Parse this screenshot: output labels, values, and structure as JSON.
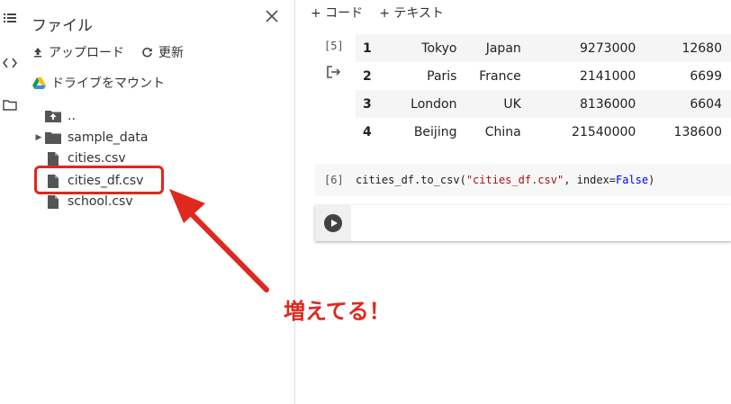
{
  "files_panel": {
    "title": "ファイル",
    "upload_label": "アップロード",
    "refresh_label": "更新",
    "mount_drive_label": "ドライブをマウント",
    "tree": [
      {
        "name": "..",
        "type": "parent-folder"
      },
      {
        "name": "sample_data",
        "type": "folder",
        "collapsed": true
      },
      {
        "name": "cities.csv",
        "type": "file"
      },
      {
        "name": "cities_df.csv",
        "type": "file",
        "highlighted": true
      },
      {
        "name": "school.csv",
        "type": "file"
      }
    ]
  },
  "toolbar": {
    "add_code_label": "+ コード",
    "add_text_label": "+ テキスト"
  },
  "cells": {
    "output_cell_label": "[5]",
    "output_table": {
      "rows": [
        {
          "index": "1",
          "city": "Tokyo",
          "country": "Japan",
          "population": "9273000",
          "extra": "12680"
        },
        {
          "index": "2",
          "city": "Paris",
          "country": "France",
          "population": "2141000",
          "extra": "6699"
        },
        {
          "index": "3",
          "city": "London",
          "country": "UK",
          "population": "8136000",
          "extra": "6604"
        },
        {
          "index": "4",
          "city": "Beijing",
          "country": "China",
          "population": "21540000",
          "extra": "138600"
        }
      ]
    },
    "code_cell_label": "[6]",
    "code_prefix": "cities_df.to_csv(",
    "code_string": "\"cities_df.csv\"",
    "code_middle": ", index=",
    "code_keyword": "False",
    "code_suffix": ")"
  },
  "annotation": {
    "text": "増えてる！",
    "color": "#e0281e"
  },
  "icons": {
    "rail": [
      "list-icon",
      "code-icon",
      "folder-icon"
    ]
  }
}
